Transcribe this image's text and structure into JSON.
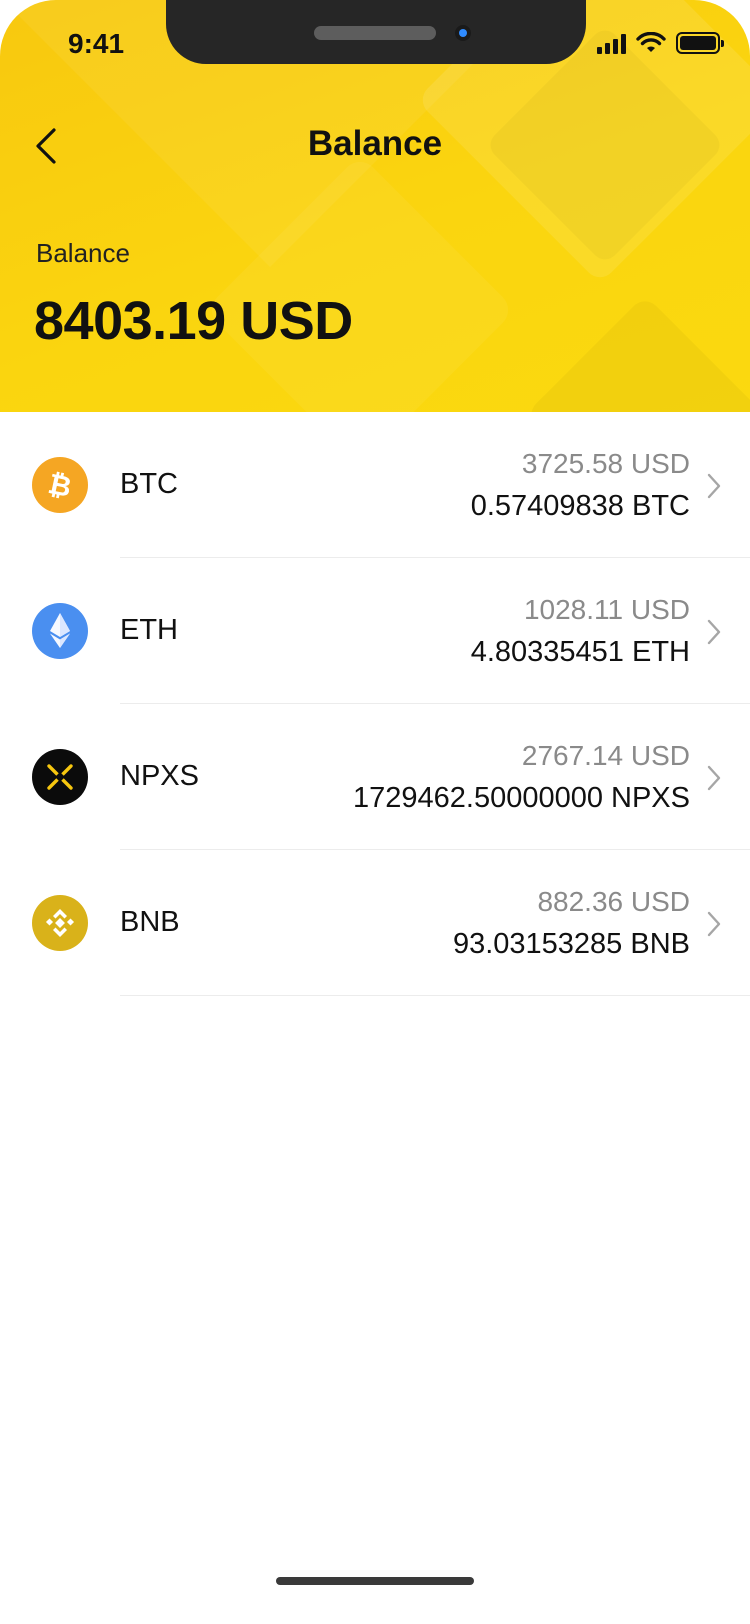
{
  "status_bar": {
    "time": "9:41"
  },
  "nav": {
    "title": "Balance",
    "back_icon": "chevron-left-icon"
  },
  "balance": {
    "label": "Balance",
    "value": "8403.19 USD"
  },
  "colors": {
    "header": "#fad50f",
    "btc": "#f5a623",
    "eth": "#4a8ff0",
    "npxs": "#0b0b0b",
    "bnb": "#d9b21a"
  },
  "assets": [
    {
      "symbol": "BTC",
      "usd": "3725.58 USD",
      "amount": "0.57409838 BTC",
      "icon": "bitcoin-icon"
    },
    {
      "symbol": "ETH",
      "usd": "1028.11 USD",
      "amount": "4.80335451 ETH",
      "icon": "ethereum-icon"
    },
    {
      "symbol": "NPXS",
      "usd": "2767.14 USD",
      "amount": "1729462.50000000 NPXS",
      "icon": "npxs-icon"
    },
    {
      "symbol": "BNB",
      "usd": "882.36 USD",
      "amount": "93.03153285 BNB",
      "icon": "binance-icon"
    }
  ]
}
